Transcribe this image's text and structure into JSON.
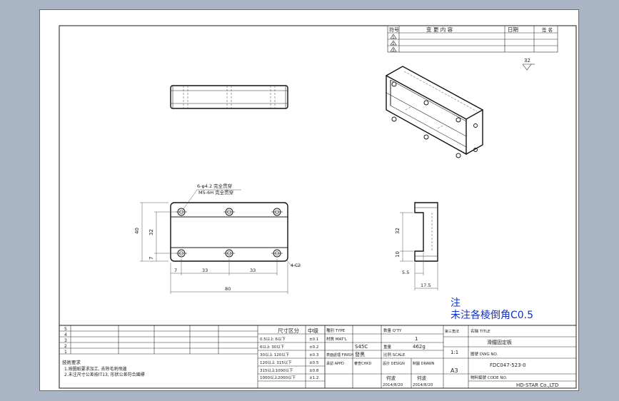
{
  "revision_table": {
    "headers": [
      "符号",
      "变 更 内 容",
      "日期",
      "签 名"
    ],
    "rows": [
      "1",
      "2",
      "3"
    ]
  },
  "surface_finish": "32",
  "hole_callout": {
    "line1": "6-φ4.2 完全贯穿",
    "line2": "M5-6H 完全贯穿"
  },
  "front_dims": {
    "vertical_total": "40",
    "vertical_mid": "32",
    "vertical_small": "7",
    "h_small": "7",
    "h_pitch1": "33",
    "h_pitch2": "33",
    "h_total": "80",
    "chamfer": "4-C2"
  },
  "side_dims": {
    "vertical_upper": "32",
    "vertical_lower": "10",
    "h_small": "5.5",
    "h_total": "17.5"
  },
  "note": {
    "title": "注",
    "text": "未注各棱倒角C0.5"
  },
  "tech_req": {
    "title": "技術要求",
    "line1": "1.按圖紙要求加工, 去除毛刺飛邊",
    "line2": "2.未注尺寸公差按IT13, 形狀公差符合國標"
  },
  "tolerance_table": {
    "header": "尺寸区分",
    "header2": "中级",
    "rows": [
      [
        "0.5以上  6以下",
        "±0.1"
      ],
      [
        "6以上  30以下",
        "±0.2"
      ],
      [
        "30以上  120以下",
        "±0.3"
      ],
      [
        "120以上 315以下",
        "±0.5"
      ],
      [
        "315以上1000以下",
        "±0.8"
      ],
      [
        "1000以上2000以下",
        "±1.2"
      ]
    ]
  },
  "title_block": {
    "type_label": "種別 TYPE",
    "qty_label": "数量 Q'TY",
    "qty": "1",
    "material_label": "材質 MAT'L",
    "material": "S45C",
    "weight_label": "重量",
    "weight": "462g",
    "finish_label": "表面處理 FINISH",
    "finish": "發黑",
    "scale_label": "比例 SCALE",
    "scale": "1:1",
    "approved_label": "承認 APPD",
    "checked_label": "審查CHKD",
    "design_label": "設計 DESIGN",
    "drawn_label": "制圖 DRAWN",
    "designer": "何波",
    "drawer": "何波",
    "date1": "2014/8/20",
    "date2": "2014/8/20",
    "size": "A3",
    "name_label": "名稱 TITLE",
    "name": "滑鐵固定板",
    "dwg_label": "圖號 DWG NO.",
    "dwg_no": "FDC047-523-0",
    "code_label": "物料編號 CODE NO.",
    "company": "HD-STAR Co.,LTD",
    "projection_label": "第三角法"
  }
}
